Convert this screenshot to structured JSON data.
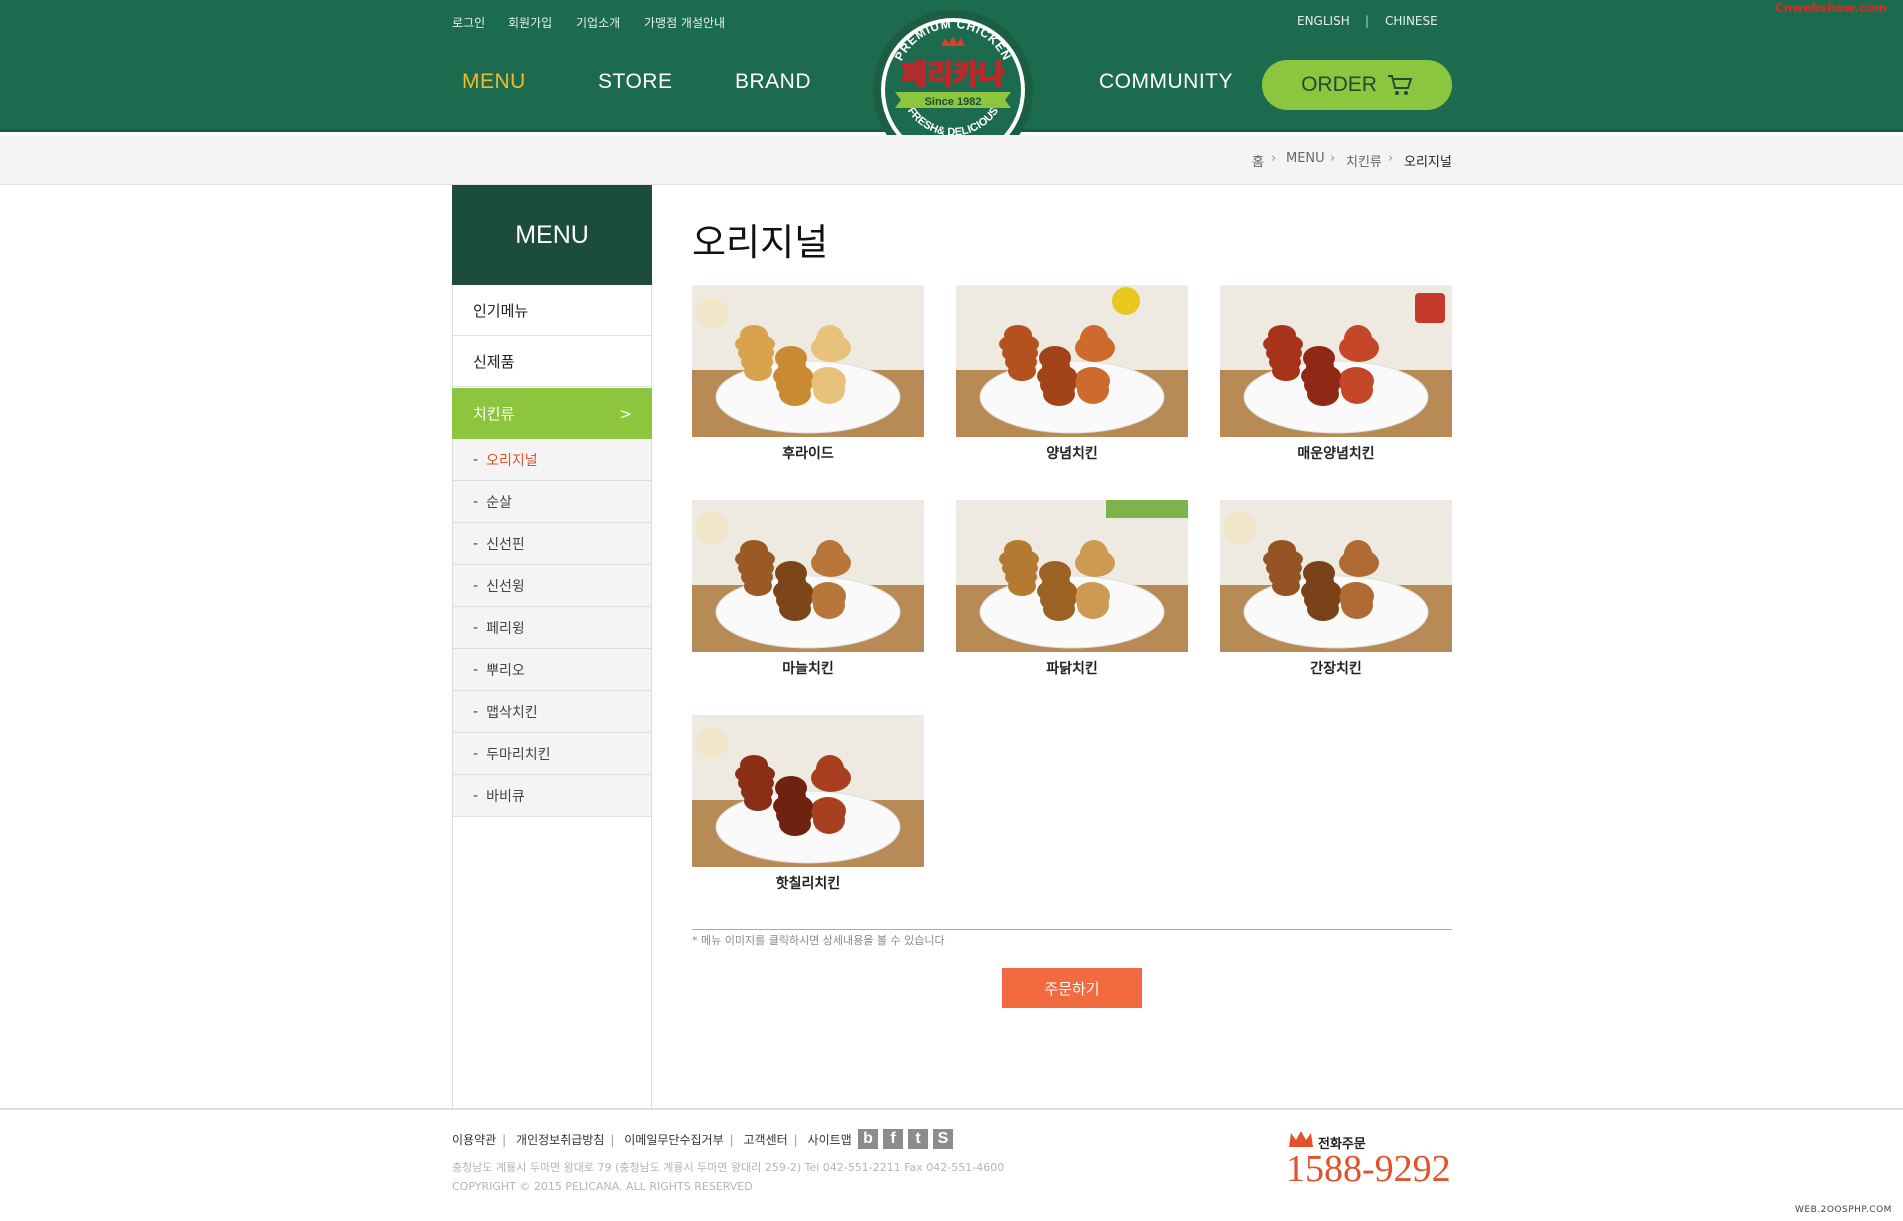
{
  "header": {
    "util_links": [
      "로그인",
      "회원가입",
      "기업소개",
      "가맹점 개설안내"
    ],
    "lang_links": [
      "ENGLISH",
      "CHINESE"
    ],
    "lang_sep": "|",
    "nav": [
      "MENU",
      "STORE",
      "BRAND",
      "COMMUNITY"
    ],
    "order_label": "ORDER",
    "logo": {
      "top_arc": "PREMIUM CHICKEN",
      "name": "페리카나",
      "since": "Since 1982",
      "bottom_arc": "FRESH& DELICIOUS"
    }
  },
  "breadcrumb": [
    "홈",
    "MENU",
    "치킨류",
    "오리지널"
  ],
  "sidebar": {
    "title": "MENU",
    "items": [
      "인기메뉴",
      "신제품",
      "치킨류"
    ],
    "active_arrow": ">",
    "sub_items": [
      "오리지널",
      "순살",
      "신선핀",
      "신선윙",
      "페리윙",
      "뿌리오",
      "맵삭치킨",
      "두마리치킨",
      "바비큐"
    ],
    "sub_prefix": "-"
  },
  "main": {
    "title": "오리지널",
    "items": [
      {
        "name": "후라이드",
        "style": "fried"
      },
      {
        "name": "양념치킨",
        "style": "sauced"
      },
      {
        "name": "매운양념치킨",
        "style": "spicy"
      },
      {
        "name": "마늘치킨",
        "style": "garlic"
      },
      {
        "name": "파닭치킨",
        "style": "green"
      },
      {
        "name": "간장치킨",
        "style": "soy"
      },
      {
        "name": "핫칠리치킨",
        "style": "chili"
      }
    ],
    "note": "* 메뉴 이미지를 클릭하시면 상세내용을 볼 수 있습니다",
    "order_button": "주문하기"
  },
  "footer": {
    "links": [
      "이용약관",
      "개인정보취급방침",
      "이메일무단수집거부",
      "고객센터",
      "사이트맵"
    ],
    "sns": [
      "b",
      "f",
      "t",
      "S"
    ],
    "address": "충청남도 계룡시 두마면 왕대로 79 (충청남도 계룡시 두마면 왕대리 259-2)    Tel 042-551-2211    Fax 042-551-4600",
    "copyright": "COPYRIGHT © 2015 PELICANA. ALL RIGHTS RESERVED",
    "phone_label": "전화주문",
    "phone": "1588-9292"
  },
  "watermarks": {
    "top": "Cnwebshow.com",
    "bottom": "WEB.2OOSPHP.COM"
  },
  "colors": {
    "header_green": "#1d6b4e",
    "accent_green": "#8cc63f",
    "accent_orange": "#f26a3f",
    "nav_active": "#f2b92e",
    "sidebar_dark": "#1b4d3a"
  }
}
